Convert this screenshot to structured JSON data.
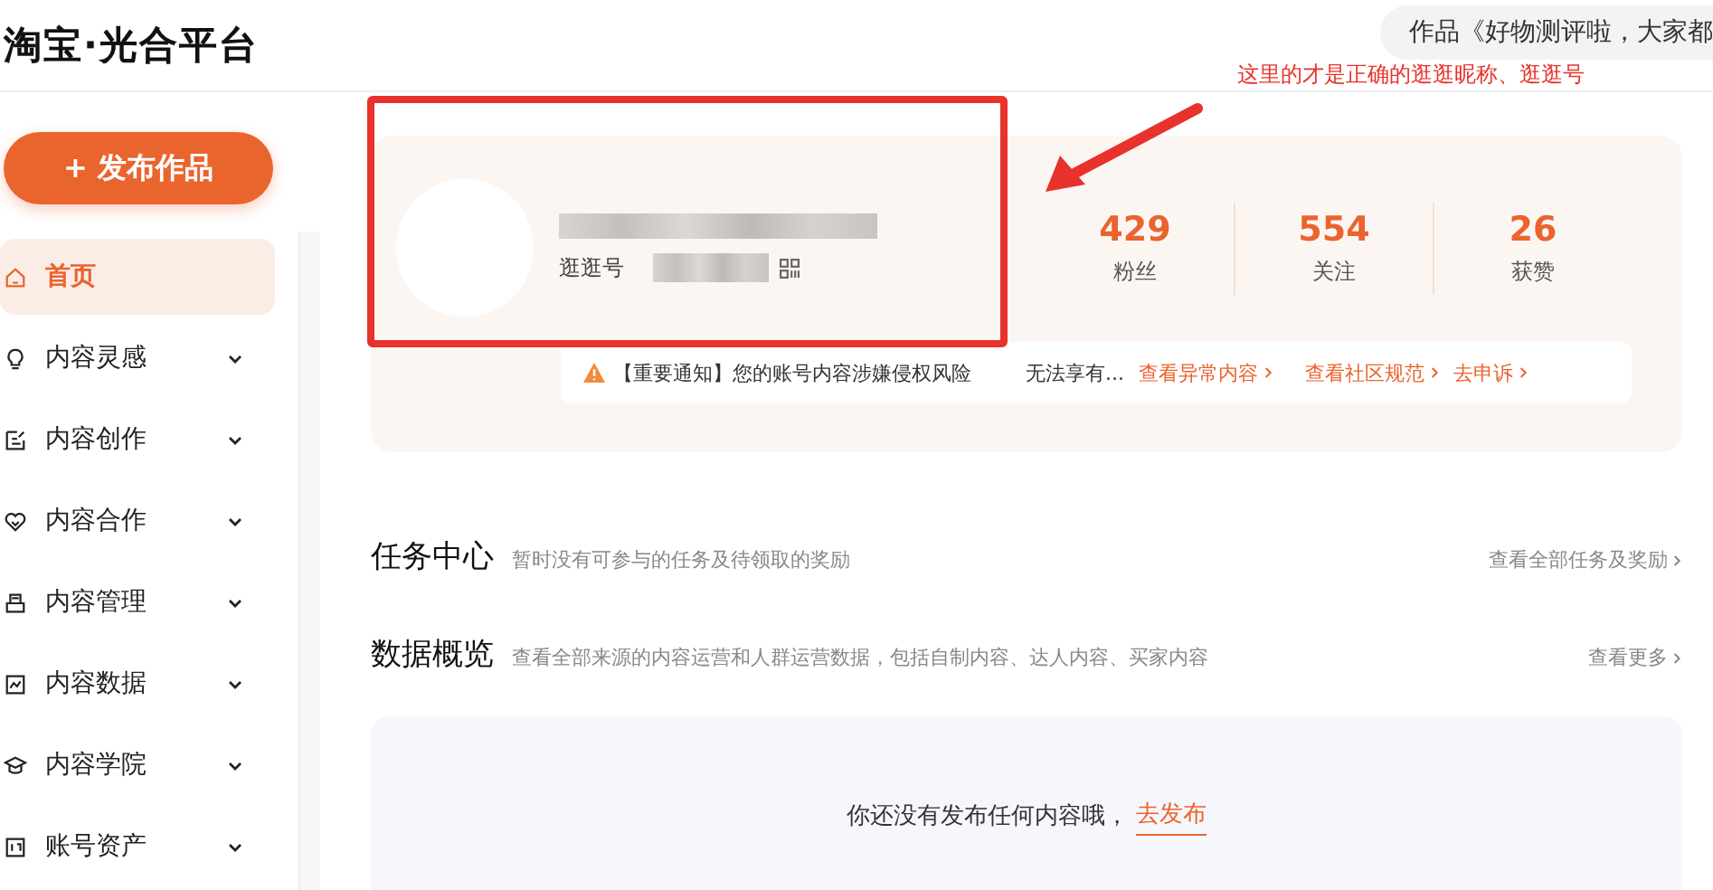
{
  "header": {
    "logo": "淘宝·光合平台",
    "notice_pill": "作品《好物测评啦，大家都"
  },
  "sidebar": {
    "publish_button": "+ 发布作品",
    "items": [
      {
        "label": "首页",
        "selected": true,
        "expandable": false
      },
      {
        "label": "内容灵感",
        "selected": false,
        "expandable": true
      },
      {
        "label": "内容创作",
        "selected": false,
        "expandable": true
      },
      {
        "label": "内容合作",
        "selected": false,
        "expandable": true
      },
      {
        "label": "内容管理",
        "selected": false,
        "expandable": true
      },
      {
        "label": "内容数据",
        "selected": false,
        "expandable": true
      },
      {
        "label": "内容学院",
        "selected": false,
        "expandable": true
      },
      {
        "label": "账号资产",
        "selected": false,
        "expandable": true
      }
    ]
  },
  "profile": {
    "id_label": "逛逛号",
    "stats": [
      {
        "value": "429",
        "label": "粉丝"
      },
      {
        "value": "554",
        "label": "关注"
      },
      {
        "value": "26",
        "label": "获赞"
      }
    ],
    "notice": {
      "text": "【重要通知】您的账号内容涉嫌侵权风险",
      "more": "无法享有...",
      "links": [
        "查看异常内容",
        "查看社区规范",
        "去申诉"
      ]
    }
  },
  "sections": [
    {
      "title": "任务中心",
      "subtitle": "暂时没有可参与的任务及待领取的奖励",
      "link": "查看全部任务及奖励"
    },
    {
      "title": "数据概览",
      "subtitle": "查看全部来源的内容运营和人群运营数据，包括自制内容、达人内容、买家内容",
      "link": "查看更多"
    }
  ],
  "empty_state": {
    "text": "你还没有发布任何内容哦，",
    "action": "去发布"
  },
  "annotation": {
    "text": "这里的才是正确的逛逛昵称、逛逛号"
  }
}
